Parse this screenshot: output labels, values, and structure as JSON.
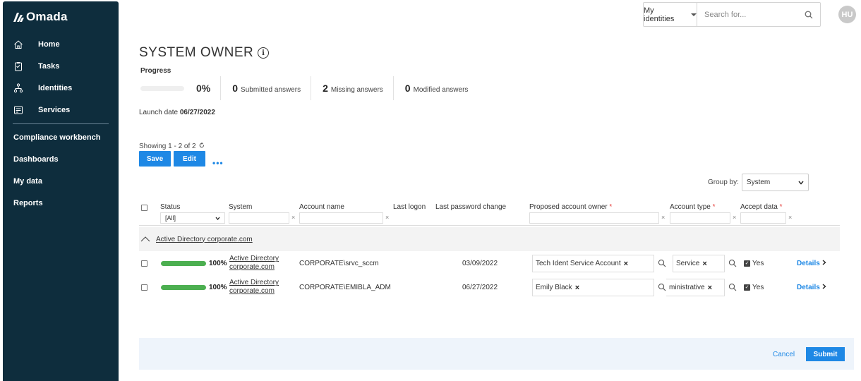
{
  "sidebar": {
    "logo": "Omada",
    "nav_items": [
      {
        "label": "Home",
        "icon": "home-icon"
      },
      {
        "label": "Tasks",
        "icon": "tasks-icon"
      },
      {
        "label": "Identities",
        "icon": "identities-icon"
      },
      {
        "label": "Services",
        "icon": "services-icon"
      }
    ],
    "plain_items": [
      "Compliance workbench",
      "Dashboards",
      "My data",
      "Reports"
    ]
  },
  "topbar": {
    "scope_label": "My identities",
    "search_placeholder": "Search for...",
    "avatar_initials": "HU"
  },
  "page": {
    "title": "SYSTEM OWNER",
    "progress_label": "Progress",
    "progress_percent": "0%",
    "progress_value": 0,
    "stats": [
      {
        "count": "0",
        "label": "Submitted answers"
      },
      {
        "count": "2",
        "label": "Missing answers"
      },
      {
        "count": "0",
        "label": "Modified answers"
      }
    ],
    "launch_label": "Launch date",
    "launch_date": "06/27/2022",
    "showing_text": "Showing 1 - 2 of 2",
    "save_label": "Save",
    "edit_label": "Edit",
    "more_label": "•••",
    "groupby_label": "Group by:",
    "groupby_value": "System"
  },
  "table": {
    "columns": {
      "status": "Status",
      "system": "System",
      "account_name": "Account name",
      "last_logon": "Last logon",
      "last_password_change": "Last password change",
      "proposed_owner": "Proposed account owner",
      "account_type": "Account type",
      "accept_data": "Accept data",
      "required_mark": "*"
    },
    "status_filter": "[All]",
    "filter_clear": "×",
    "group_name": "Active Directory corporate.com",
    "rows": [
      {
        "progress_pct": "100%",
        "progress_value": 100,
        "system_line1": "Active Directory",
        "system_line2": "corporate.com",
        "account_name": "CORPORATE\\srvc_sccm",
        "last_logon": "",
        "last_password_change": "03/09/2022",
        "owner": "Tech Ident Service Account",
        "account_type": "Service",
        "accept": "Yes",
        "details": "Details"
      },
      {
        "progress_pct": "100%",
        "progress_value": 100,
        "system_line1": "Active Directory",
        "system_line2": "corporate.com",
        "account_name": "CORPORATE\\EMIBLA_ADM",
        "last_logon": "",
        "last_password_change": "06/27/2022",
        "owner": "Emily Black",
        "account_type": "ministrative",
        "accept": "Yes",
        "details": "Details"
      }
    ],
    "remove_mark": "×"
  },
  "footer": {
    "cancel_label": "Cancel",
    "submit_label": "Submit"
  },
  "colors": {
    "sidebar_bg": "#0e2d3d",
    "accent": "#1e88e5",
    "progress_green": "#4caf50",
    "required_red": "#e53935"
  }
}
